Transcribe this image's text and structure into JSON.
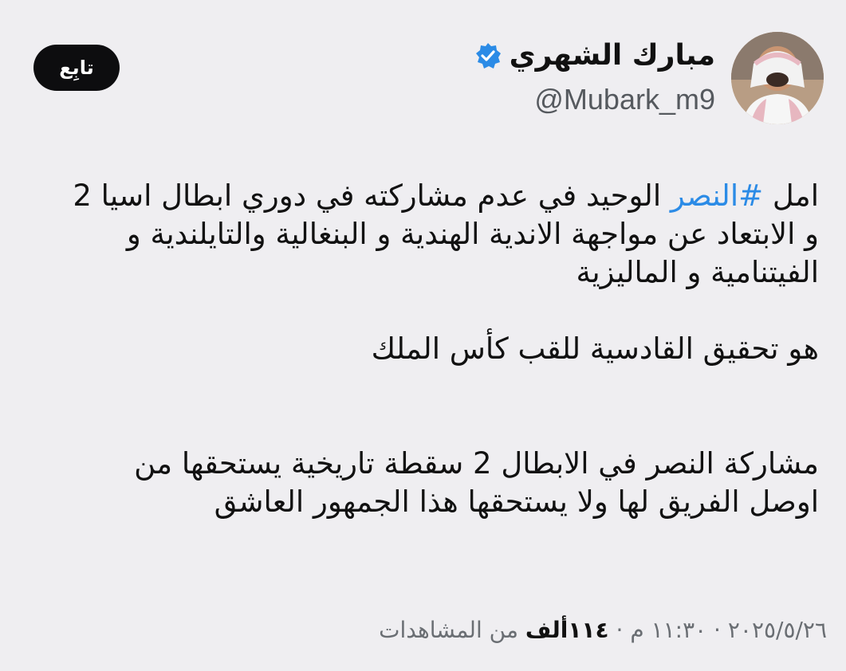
{
  "tweet": {
    "author": {
      "display_name": "مبارك الشهري",
      "handle": "@Mubark_m9",
      "verified": true,
      "verified_color": "#2b8be6"
    },
    "follow_button_label": "تابِع",
    "body": {
      "p1_line1_prefix": "امل ",
      "p1_hashtag": "#النصر",
      "p1_line1_suffix": " الوحيد في عدم مشاركته في دوري ابطال اسيا 2",
      "p1_line2": "و الابتعاد عن مواجهة الاندية الهندية و البنغالية والتايلندية و",
      "p1_line3": "الفيتنامية و  الماليزية",
      "p2_line1": "هو تحقيق القادسية للقب كأس الملك",
      "p3_line1": "مشاركة النصر في الابطال 2  سقطة تاريخية يستحقها من",
      "p3_line2": "اوصل الفريق لها  ولا يستحقها هذا الجمهور العاشق"
    },
    "meta": {
      "date": "٢٠٢٥/٥/٢٦",
      "separator1": " · ",
      "time": "١١:٣٠ م",
      "separator2": " · ",
      "views_count": "١١٤ألف",
      "views_label": " من المشاهدات"
    }
  }
}
